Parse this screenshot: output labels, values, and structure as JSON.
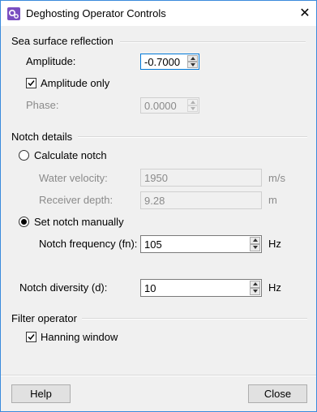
{
  "window": {
    "title": "Deghosting Operator Controls",
    "close_glyph": "✕",
    "icon": "app-gears-icon"
  },
  "sea_surface": {
    "section_label": "Sea surface reflection",
    "amplitude_label": "Amplitude:",
    "amplitude_value": "-0.7000",
    "amplitude_only_label": "Amplitude only",
    "amplitude_only_checked": true,
    "phase_label": "Phase:",
    "phase_value": "0.0000"
  },
  "notch": {
    "section_label": "Notch details",
    "calculate_label": "Calculate notch",
    "water_velocity_label": "Water velocity:",
    "water_velocity_value": "1950",
    "water_velocity_unit": "m/s",
    "receiver_depth_label": "Receiver depth:",
    "receiver_depth_value": "9.28",
    "receiver_depth_unit": "m",
    "set_manual_label": "Set notch manually",
    "selected_mode": "set_manual",
    "notch_frequency_label": "Notch frequency (fn):",
    "notch_frequency_value": "105",
    "notch_frequency_unit": "Hz",
    "notch_diversity_label": "Notch diversity (d):",
    "notch_diversity_value": "10",
    "notch_diversity_unit": "Hz"
  },
  "filter": {
    "section_label": "Filter operator",
    "hanning_label": "Hanning window",
    "hanning_checked": true
  },
  "buttons": {
    "help_label": "Help",
    "close_label": "Close"
  }
}
